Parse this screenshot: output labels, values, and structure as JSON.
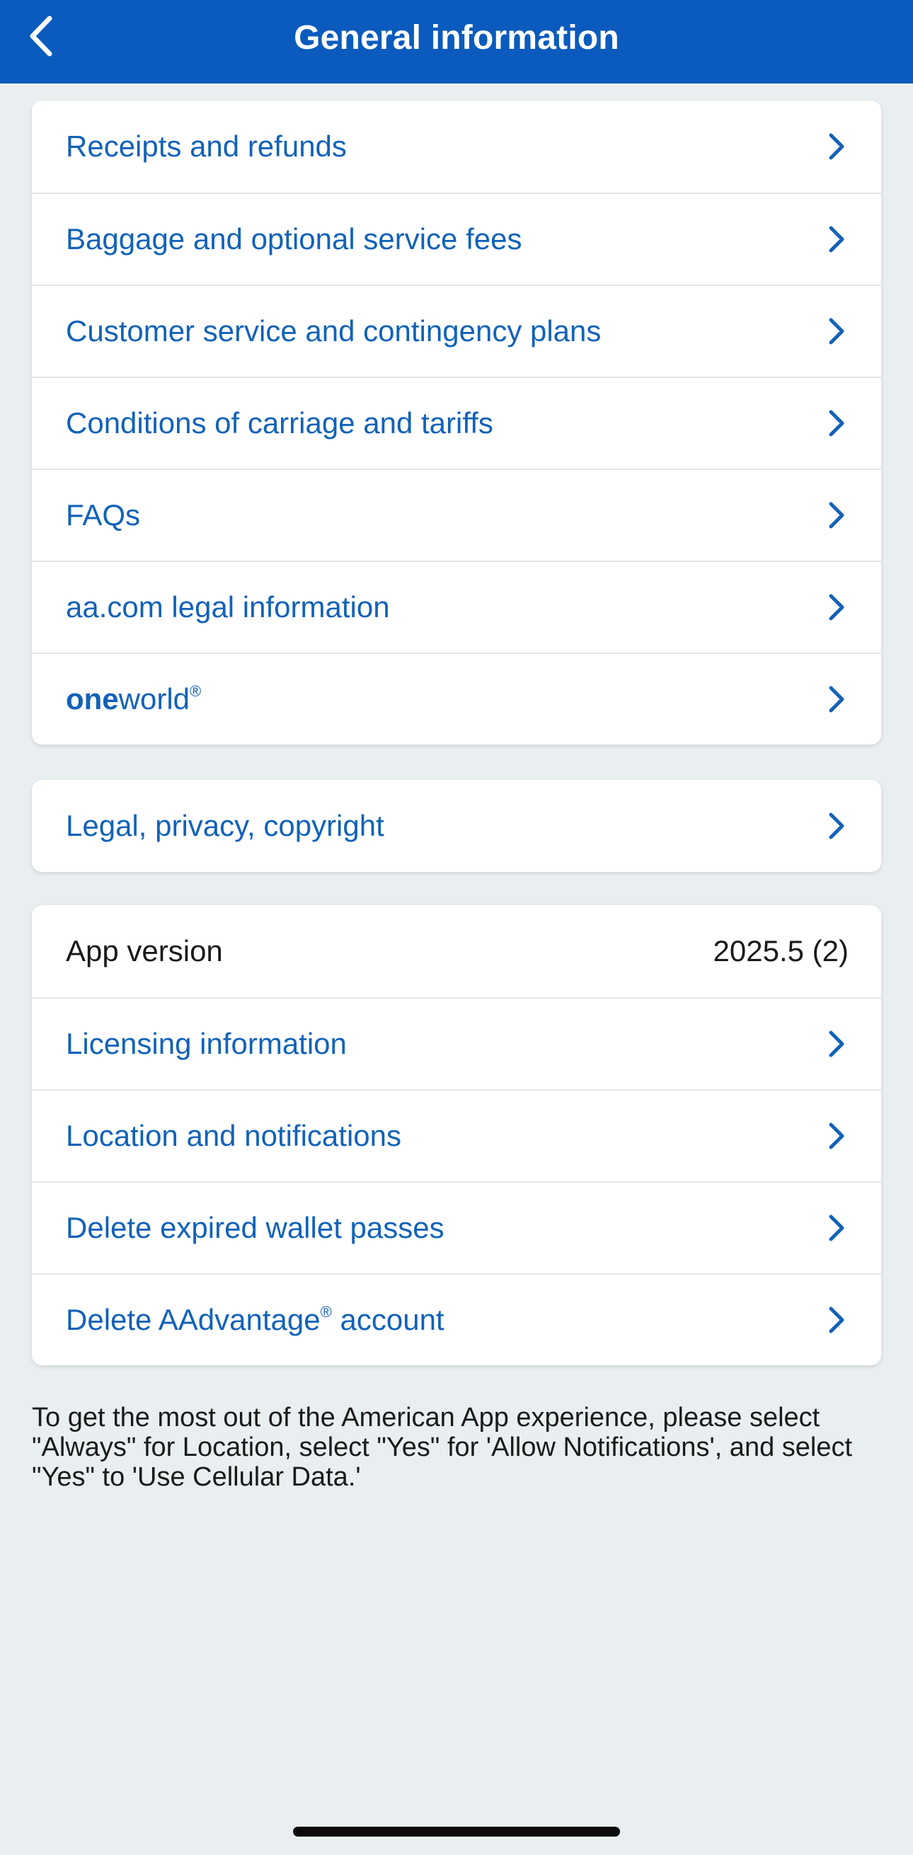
{
  "header": {
    "title": "General information",
    "back_icon": "chevron-left-icon"
  },
  "general_links": [
    {
      "label": "Receipts and refunds"
    },
    {
      "label": "Baggage and optional service fees"
    },
    {
      "label": "Customer service and contingency plans"
    },
    {
      "label": "Conditions of carriage and tariffs"
    },
    {
      "label": "FAQs"
    },
    {
      "label": "aa.com legal information"
    }
  ],
  "oneworld": {
    "bold": "one",
    "regular": "world",
    "mark": "®"
  },
  "legal": {
    "label": "Legal, privacy, copyright"
  },
  "app_info": {
    "version_label": "App version",
    "version_value": "2025.5 (2)",
    "links": [
      {
        "label": "Licensing information"
      },
      {
        "label": "Location and notifications"
      },
      {
        "label": "Delete expired wallet passes"
      }
    ],
    "delete_account": {
      "prefix": "Delete AAdvantage",
      "mark": "®",
      "suffix": " account"
    }
  },
  "note": "To get the most out of the American App experience, please select \"Always\" for Location, select \"Yes\" for 'Allow Notifications', and select \"Yes\" to 'Use Cellular Data.'",
  "colors": {
    "header_bg": "#0a5bbd",
    "link": "#1262b8",
    "page_bg": "#e9eef0"
  }
}
